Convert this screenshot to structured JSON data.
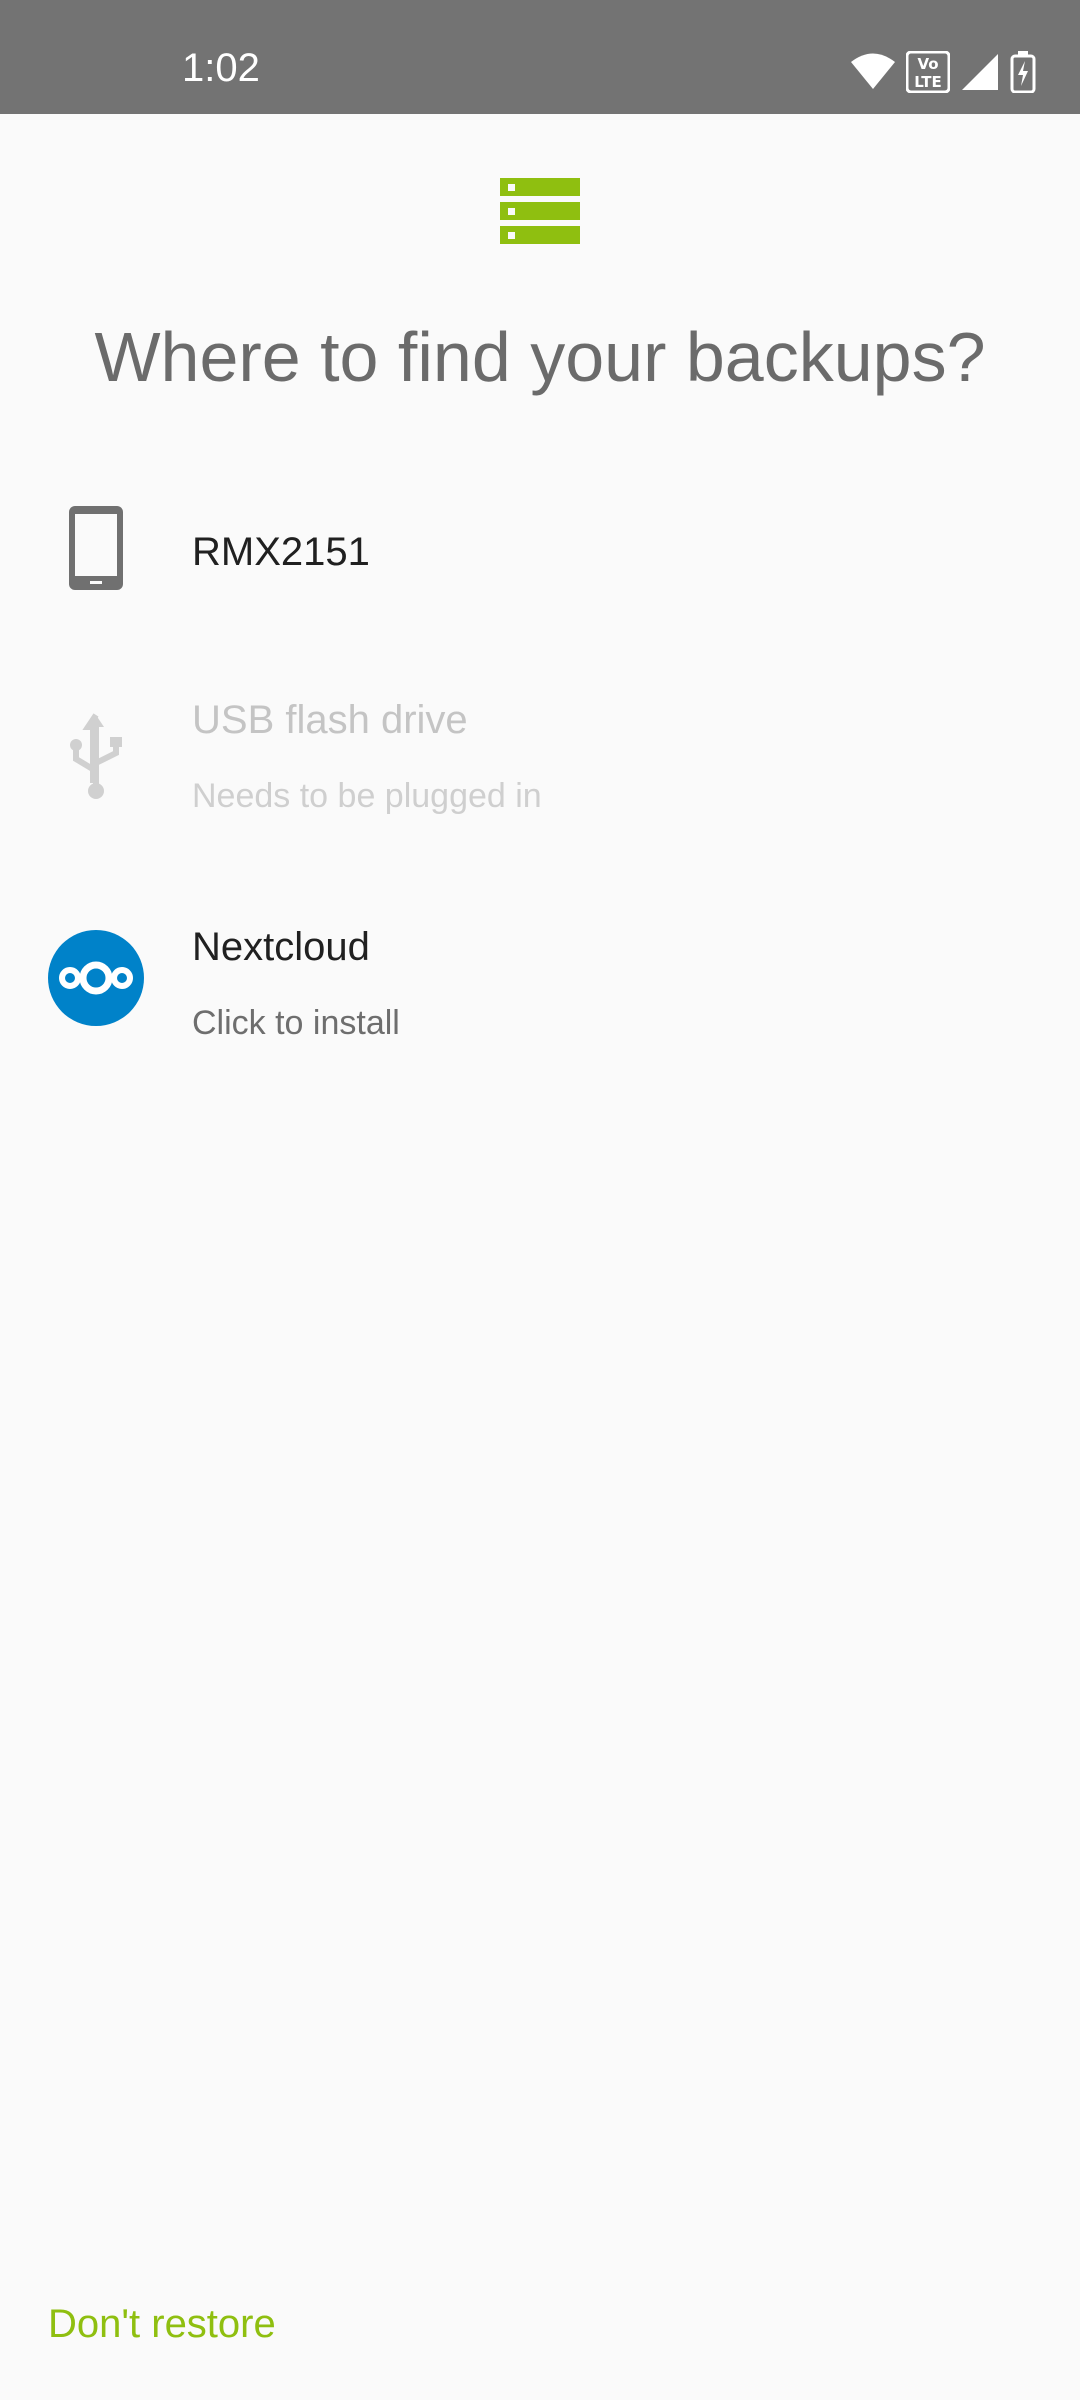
{
  "status_bar": {
    "time": "1:02",
    "icons": [
      "wifi-icon",
      "volte-icon",
      "signal-icon",
      "battery-charging-icon"
    ]
  },
  "header": {
    "icon": "storage-icon",
    "title": "Where to find your backups?"
  },
  "options": [
    {
      "icon": "phone-icon",
      "title": "RMX2151",
      "subtitle": "",
      "enabled": true
    },
    {
      "icon": "usb-icon",
      "title": "USB flash drive",
      "subtitle": "Needs to be plugged in",
      "enabled": false
    },
    {
      "icon": "nextcloud-icon",
      "title": "Nextcloud",
      "subtitle": "Click to install",
      "enabled": true
    }
  ],
  "footer": {
    "dont_restore_label": "Don't restore"
  },
  "colors": {
    "accent": "#8fbf10",
    "status_bar": "#737373",
    "background": "#fafafa",
    "nextcloud_blue": "#0082c9"
  }
}
